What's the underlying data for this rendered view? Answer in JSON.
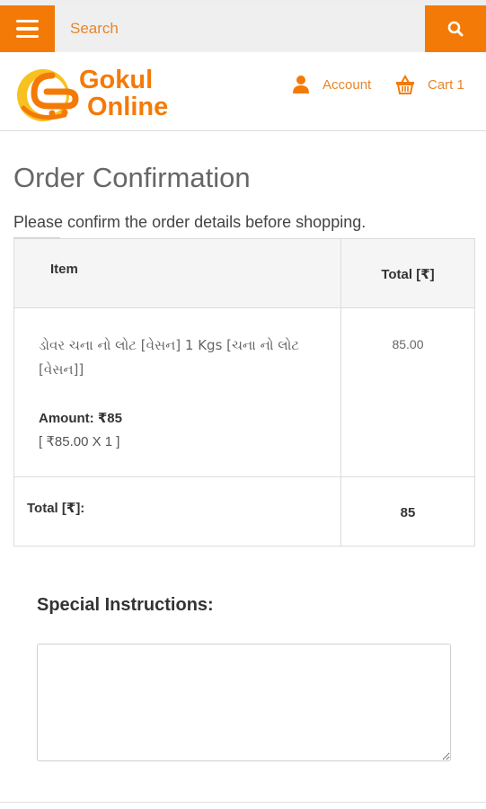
{
  "search": {
    "placeholder": "Search"
  },
  "brand": {
    "line1": "Gokul",
    "line2": "Online",
    "accent_color": "#f47a07"
  },
  "nav": {
    "account_label": "Account",
    "cart_label": "Cart 1"
  },
  "page": {
    "title": "Order Confirmation",
    "subtitle": "Please confirm the order details before shopping."
  },
  "order_table": {
    "headers": {
      "item": "Item",
      "total": "Total [₹]"
    },
    "items": [
      {
        "name": "ડોવર ચના નો લોટ [વેસન] 1 Kgs [ચના નો લોટ [વેસન]]",
        "amount": "Amount: ₹85",
        "calc": "[ ₹85.00 X 1 ]",
        "total": "85.00"
      }
    ],
    "total_label": "Total [₹]:",
    "total_value": "85"
  },
  "special_instructions": {
    "label": "Special Instructions:",
    "value": ""
  }
}
